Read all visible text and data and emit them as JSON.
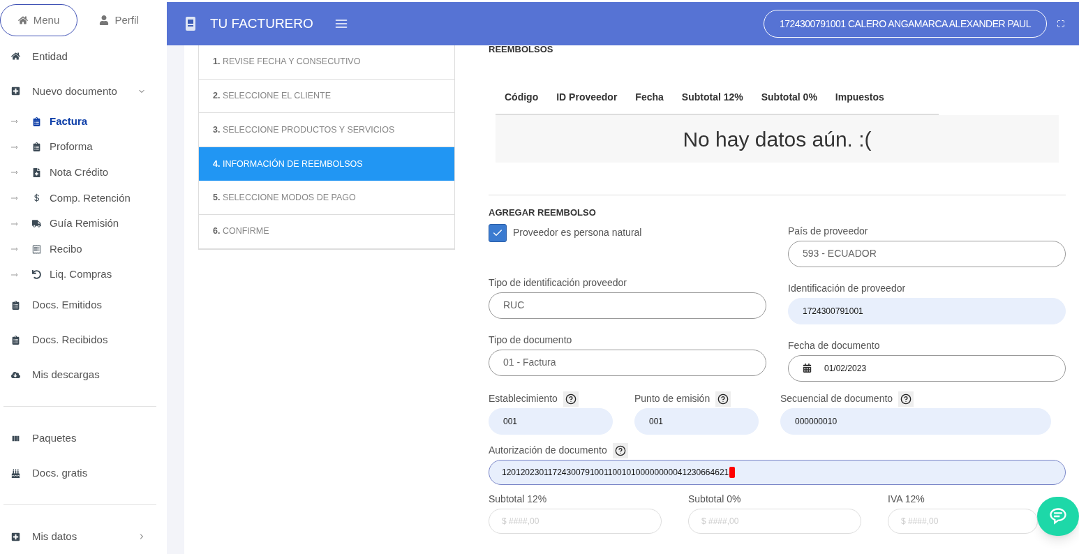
{
  "sidebar": {
    "top_buttons": [
      {
        "label": "Menu",
        "selected": true
      },
      {
        "label": "Perfil",
        "selected": false
      }
    ],
    "items": [
      {
        "label": "Entidad",
        "kind": "item",
        "selected": false
      },
      {
        "label": "Nuevo documento",
        "kind": "group",
        "expanded": true,
        "selected": false,
        "children": [
          {
            "label": "Factura",
            "selected": true
          },
          {
            "label": "Proforma",
            "selected": false
          },
          {
            "label": "Nota Crédito",
            "selected": false
          },
          {
            "label": "Comp. Retención",
            "selected": false
          },
          {
            "label": "Guía Remisión",
            "selected": false
          },
          {
            "label": "Recibo",
            "selected": false
          },
          {
            "label": "Liq. Compras",
            "selected": false
          }
        ]
      },
      {
        "label": "Docs. Emitidos",
        "kind": "item",
        "selected": false
      },
      {
        "label": "Docs. Recibidos",
        "kind": "item",
        "selected": false
      },
      {
        "label": "Mis descargas",
        "kind": "item",
        "selected": false
      },
      {
        "kind": "divider"
      },
      {
        "label": "Paquetes",
        "kind": "item",
        "selected": false
      },
      {
        "label": "Docs. gratis",
        "kind": "item",
        "selected": false
      },
      {
        "kind": "divider"
      },
      {
        "label": "Mis datos",
        "kind": "group",
        "expanded": false,
        "selected": false
      }
    ]
  },
  "header": {
    "title": "TU FACTURERO",
    "user": "1724300791001 CALERO ANGAMARCA ALEXANDER PAUL"
  },
  "steps": [
    {
      "number": "1.",
      "label": "REVISE FECHA Y CONSECUTIVO",
      "selected": false
    },
    {
      "number": "2.",
      "label": "SELECCIONE EL CLIENTE",
      "selected": false
    },
    {
      "number": "3.",
      "label": "SELECCIONE PRODUCTOS Y SERVICIOS",
      "selected": false
    },
    {
      "number": "4.",
      "label": "INFORMACIÓN DE REEMBOLSOS",
      "selected": true
    },
    {
      "number": "5.",
      "label": "SELECCIONE MODOS DE PAGO",
      "selected": false
    },
    {
      "number": "6.",
      "label": "CONFIRME",
      "selected": false
    }
  ],
  "reembolsos": {
    "title": "REEMBOLSOS",
    "columns": [
      "Código",
      "ID Proveedor",
      "Fecha",
      "Subtotal 12%",
      "Subtotal 0%",
      "Impuestos"
    ],
    "empty_message": "No hay datos aún. :("
  },
  "agregar": {
    "title": "AGREGAR REEMBOLSO",
    "natural": {
      "label": "Proveedor es persona natural",
      "checked": true
    },
    "pais": {
      "label": "País de proveedor",
      "value": "593 - ECUADOR"
    },
    "tipo_identificacion": {
      "label": "Tipo de identificación proveedor",
      "value": "RUC"
    },
    "identificacion": {
      "label": "Identificación de proveedor",
      "value": "1724300791001"
    },
    "tipo_documento": {
      "label": "Tipo de documento",
      "value": "01 - Factura"
    },
    "fecha": {
      "label": "Fecha de documento",
      "value": "01/02/2023"
    },
    "establecimiento": {
      "label": "Establecimiento",
      "value": "001"
    },
    "punto": {
      "label": "Punto de emisión",
      "value": "001"
    },
    "secuencial": {
      "label": "Secuencial de documento",
      "value": "000000010"
    },
    "autorizacion": {
      "label": "Autorización de documento",
      "value": "1201202301172430079100110010100000000041230664621"
    },
    "totals": [
      {
        "label": "Subtotal 12%",
        "placeholder": "$ ####,00"
      },
      {
        "label": "Subtotal 0%",
        "placeholder": "$ ####,00"
      },
      {
        "label": "IVA 12%",
        "placeholder": "$ ####,00"
      }
    ]
  }
}
